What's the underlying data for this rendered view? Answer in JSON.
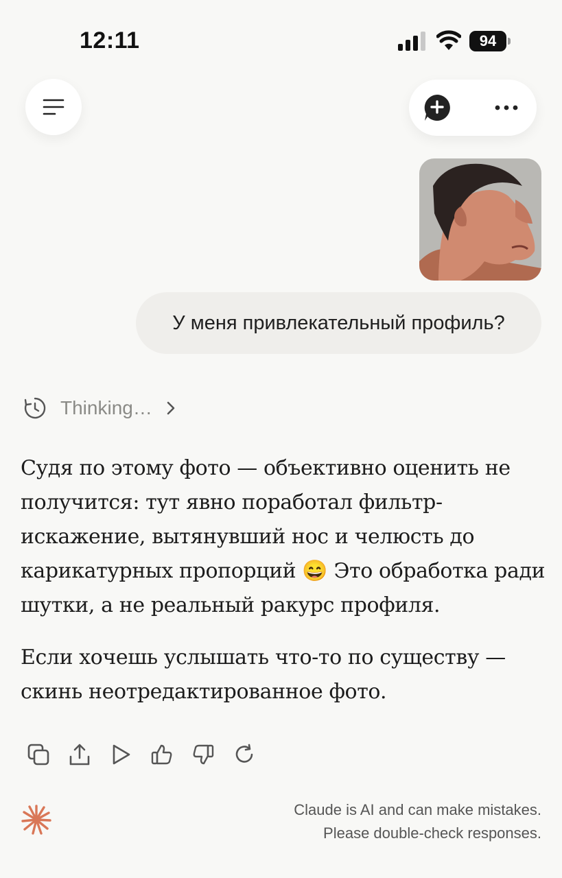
{
  "status_bar": {
    "time": "12:11",
    "battery": "94"
  },
  "header": {
    "menu_icon": "menu-lines-icon",
    "new_chat_icon": "new-chat-plus-icon",
    "more_icon": "more-dots-icon"
  },
  "user_message": {
    "text": "У меня привлекательный профиль?"
  },
  "thinking": {
    "label": "Thinking…"
  },
  "response": {
    "paragraph1_a": "Судя по этому фото — объективно оценить не получится: тут явно поработал фильтр-искажение, вытянувший нос и челюсть до карикатурных пропорций ",
    "emoji": "😄",
    "paragraph1_b": " Это обработка ради шутки, а не реальный ракурс профиля.",
    "paragraph2": "Если хочешь услышать что-то по существу — скинь неотредактированное фото."
  },
  "actions": [
    "copy-icon",
    "share-icon",
    "play-icon",
    "thumbs-up-icon",
    "thumbs-down-icon",
    "retry-icon"
  ],
  "footer": {
    "disclaimer_line1": "Claude is AI and can make mistakes.",
    "disclaimer_line2": "Please double-check responses."
  },
  "colors": {
    "background": "#f8f8f6",
    "bubble": "#efeeeb",
    "claude_accent": "#d97757"
  }
}
